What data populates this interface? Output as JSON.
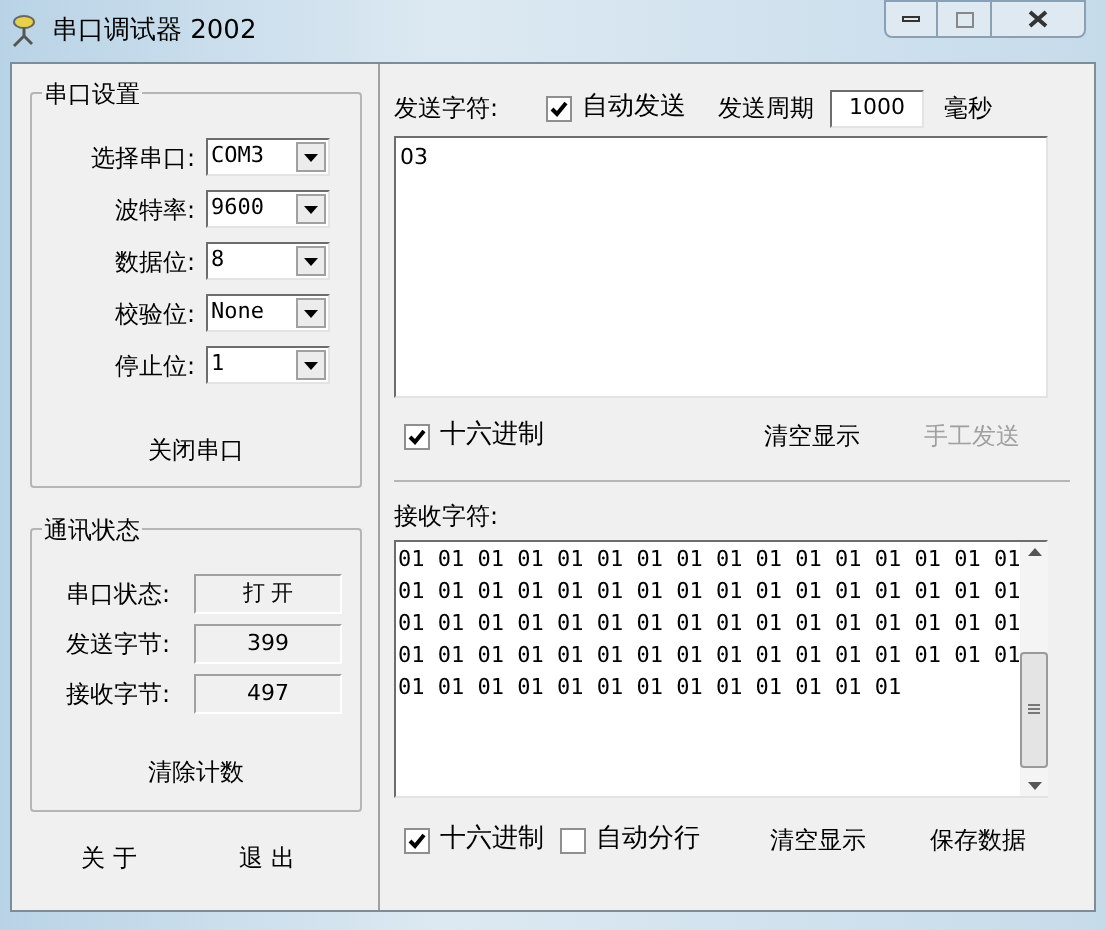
{
  "window": {
    "title": "串口调试器 2002"
  },
  "port_settings": {
    "title": "串口设置",
    "fields": [
      {
        "label": "选择串口:",
        "value": "COM3"
      },
      {
        "label": "波特率:",
        "value": "9600"
      },
      {
        "label": "数据位:",
        "value": "8"
      },
      {
        "label": "校验位:",
        "value": "None"
      },
      {
        "label": "停止位:",
        "value": "1"
      }
    ],
    "button": "关闭串口"
  },
  "status": {
    "title": "通讯状态",
    "rows": [
      {
        "label": "串口状态:",
        "value": "打 开"
      },
      {
        "label": "发送字节:",
        "value": "399"
      },
      {
        "label": "接收字节:",
        "value": "497"
      }
    ],
    "button": "清除计数"
  },
  "bottom_buttons": [
    "关 于",
    "退 出"
  ],
  "send": {
    "label": "发送字符:",
    "auto_send": {
      "label": "自动发送",
      "checked": true
    },
    "period_label": "发送周期",
    "period": "1000",
    "unit": "毫秒",
    "text": "03",
    "hex": {
      "label": "十六进制",
      "checked": true
    },
    "clear": {
      "label": "清空显示",
      "disabled": false
    },
    "manual": {
      "label": "手工发送",
      "disabled": true
    }
  },
  "receive": {
    "label": "接收字符:",
    "lines": [
      "01 01 01 01 01 01 01 01 01 01 01 01 01 01 01 01",
      "01 01 01 01 01 01 01 01 01 01 01 01 01 01 01 01",
      "01 01 01 01 01 01 01 01 01 01 01 01 01 01 01 01",
      "01 01 01 01 01 01 01 01 01 01 01 01 01 01 01 01",
      "01 01 01 01 01 01 01 01 01 01 01 01 01"
    ],
    "hex": {
      "label": "十六进制",
      "checked": true
    },
    "auto_wrap": {
      "label": "自动分行",
      "checked": false
    },
    "clear": "清空显示",
    "save": "保存数据"
  }
}
